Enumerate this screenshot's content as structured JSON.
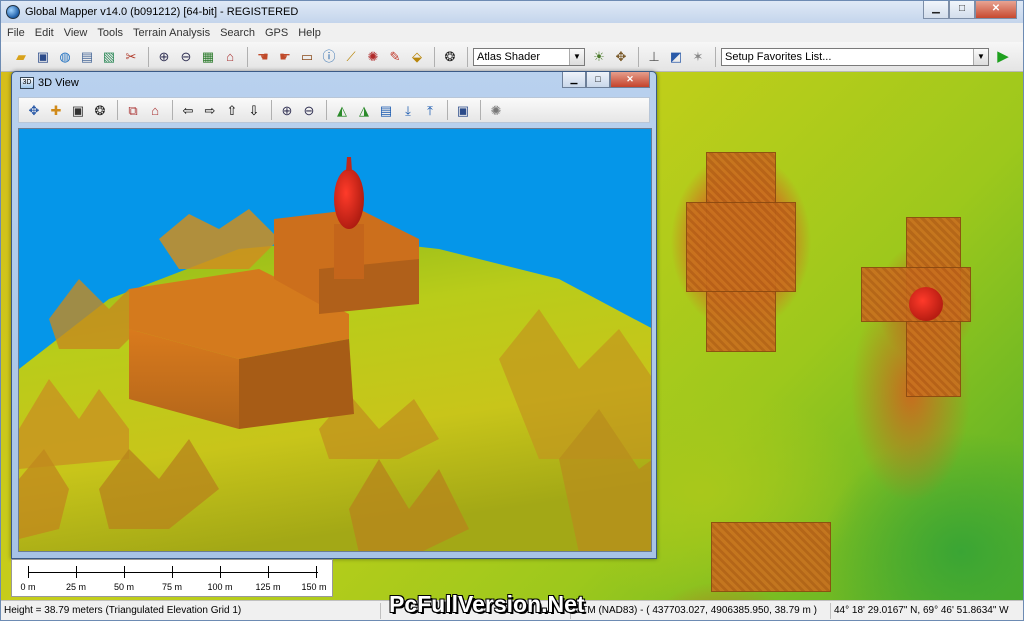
{
  "app": {
    "title": "Global Mapper v14.0 (b091212) [64-bit] - REGISTERED"
  },
  "window_controls": {
    "minimize": "▁",
    "maximize": "□",
    "close": "✕"
  },
  "menu": [
    "File",
    "Edit",
    "View",
    "Tools",
    "Terrain Analysis",
    "Search",
    "GPS",
    "Help"
  ],
  "toolbar": {
    "shader_select": "Atlas Shader",
    "favorites_select": "Setup Favorites List..."
  },
  "view3d": {
    "title": "3D View",
    "icon_text": "3D"
  },
  "scale": {
    "labels": [
      "0 m",
      "25 m",
      "50 m",
      "75 m",
      "100 m",
      "125 m",
      "150 m"
    ]
  },
  "status": {
    "height": "Height = 38.79 meters (Triangulated Elevation Grid 1)",
    "utm": "UTM (NAD83) - ( 437703.027, 4906385.950, 38.79 m )",
    "latlon": "44° 18' 29.0167\" N, 69° 46' 51.8634\" W"
  },
  "watermark": "PcFullVersion.Net",
  "colors": {
    "sky": "#0596e9",
    "terrain_low": "#4fae2a",
    "terrain_mid": "#c3cf1a",
    "terrain_high": "#c9701f",
    "peak": "#d21f12"
  }
}
